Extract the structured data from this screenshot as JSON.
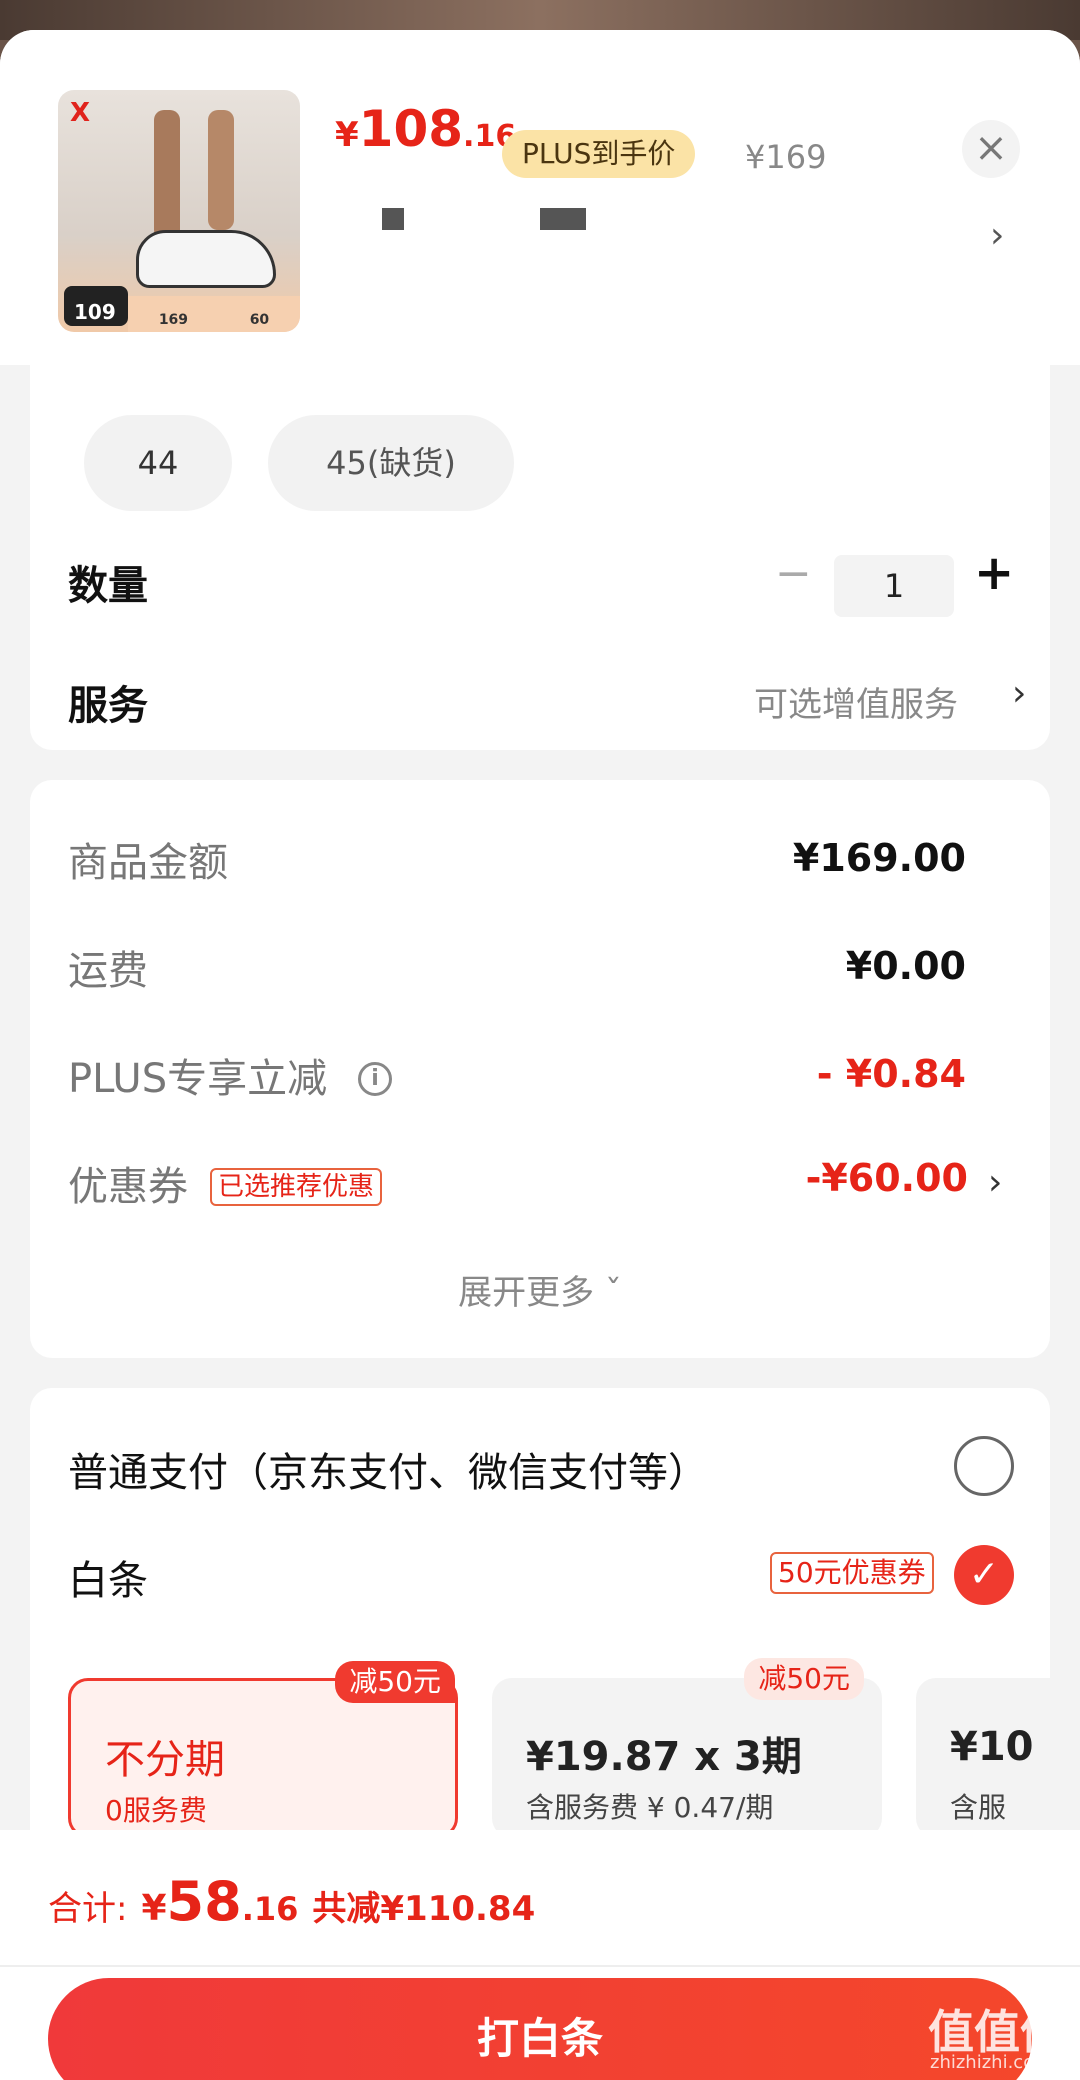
{
  "product": {
    "thumb_logo": "X",
    "thumb_price": "109",
    "thumb_strip": [
      "169",
      "60"
    ],
    "price_yen": "¥",
    "price_int": "108",
    "price_dec": ".16",
    "plus_tag": "PLUS到手价",
    "original_price": "¥169"
  },
  "close_label": "×",
  "spec_chevron": "›",
  "sizes": [
    "44",
    "45(缺货)"
  ],
  "quantity": {
    "label": "数量",
    "minus": "−",
    "value": "1",
    "plus": "+"
  },
  "service": {
    "label": "服务",
    "value": "可选增值服务",
    "chevron": "›"
  },
  "summary": {
    "rows": [
      {
        "label": "商品金额",
        "value": "¥169.00"
      },
      {
        "label": "运费",
        "value": "¥0.00"
      },
      {
        "label": "PLUS专享立减",
        "value": "- ¥0.84"
      },
      {
        "label": "优惠券",
        "value": "-¥60.00"
      }
    ],
    "info_icon": "i",
    "coupon_tag": "已选推荐优惠",
    "coupon_chevron": "›",
    "expand": "展开更多 ˇ"
  },
  "payment": {
    "normal_label": "普通支付（京东支付、微信支付等）",
    "baitiao_label": "白条",
    "baitiao_coupon": "50元优惠券",
    "check": "✓",
    "plans": [
      {
        "title": "不分期",
        "sub": "0服务费",
        "badge": "减50元"
      },
      {
        "title": "¥19.87 x 3期",
        "sub": "含服务费 ¥ 0.47/期",
        "badge": "减50元"
      },
      {
        "title": "¥10",
        "sub": "含服"
      }
    ]
  },
  "footer": {
    "total_label": "合计:",
    "total_yen": "¥",
    "total_int": "58",
    "total_dec": ".16",
    "saved": "共减¥110.84",
    "submit": "打白条"
  },
  "watermark": {
    "logo": "值值值",
    "url": "zhizhizhi.com"
  },
  "colors": {
    "accent": "#e62418",
    "button": "#f0393a",
    "plus_tag": "#fbe3a6"
  }
}
